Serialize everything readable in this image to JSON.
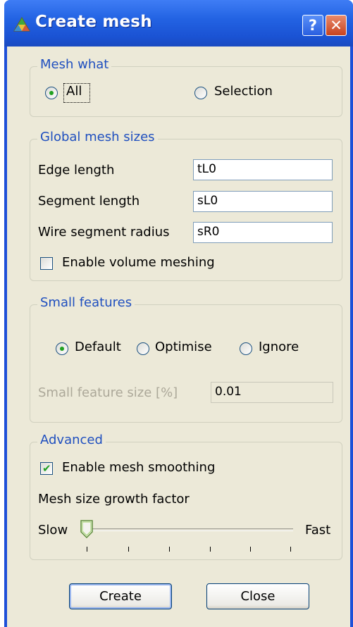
{
  "window": {
    "title": "Create mesh",
    "help_glyph": "?",
    "close_glyph": "✕",
    "icon": "mesh-app-icon"
  },
  "mesh_what": {
    "title": "Mesh what",
    "options": [
      "All",
      "Selection"
    ],
    "selected": "All"
  },
  "global_mesh_sizes": {
    "title": "Global mesh sizes",
    "edge_length_label": "Edge length",
    "edge_length_value": "tL0",
    "segment_length_label": "Segment length",
    "segment_length_value": "sL0",
    "wire_radius_label": "Wire segment radius",
    "wire_radius_value": "sR0",
    "volume_meshing_label": "Enable volume meshing",
    "volume_meshing_checked": false
  },
  "small_features": {
    "title": "Small features",
    "options": [
      "Default",
      "Optimise",
      "Ignore"
    ],
    "selected": "Default",
    "size_label": "Small feature size [%]",
    "size_value": "0.01"
  },
  "advanced": {
    "title": "Advanced",
    "smoothing_label": "Enable mesh smoothing",
    "smoothing_checked": true,
    "growth_label": "Mesh size growth factor",
    "slider_min_label": "Slow",
    "slider_max_label": "Fast",
    "slider_value_fraction": 0.0
  },
  "buttons": {
    "create": "Create",
    "close": "Close"
  },
  "colors": {
    "titlebar": "#2363e3",
    "group_title": "#1f4fbf",
    "client_bg": "#ece9d8",
    "check_green": "#21a121"
  }
}
